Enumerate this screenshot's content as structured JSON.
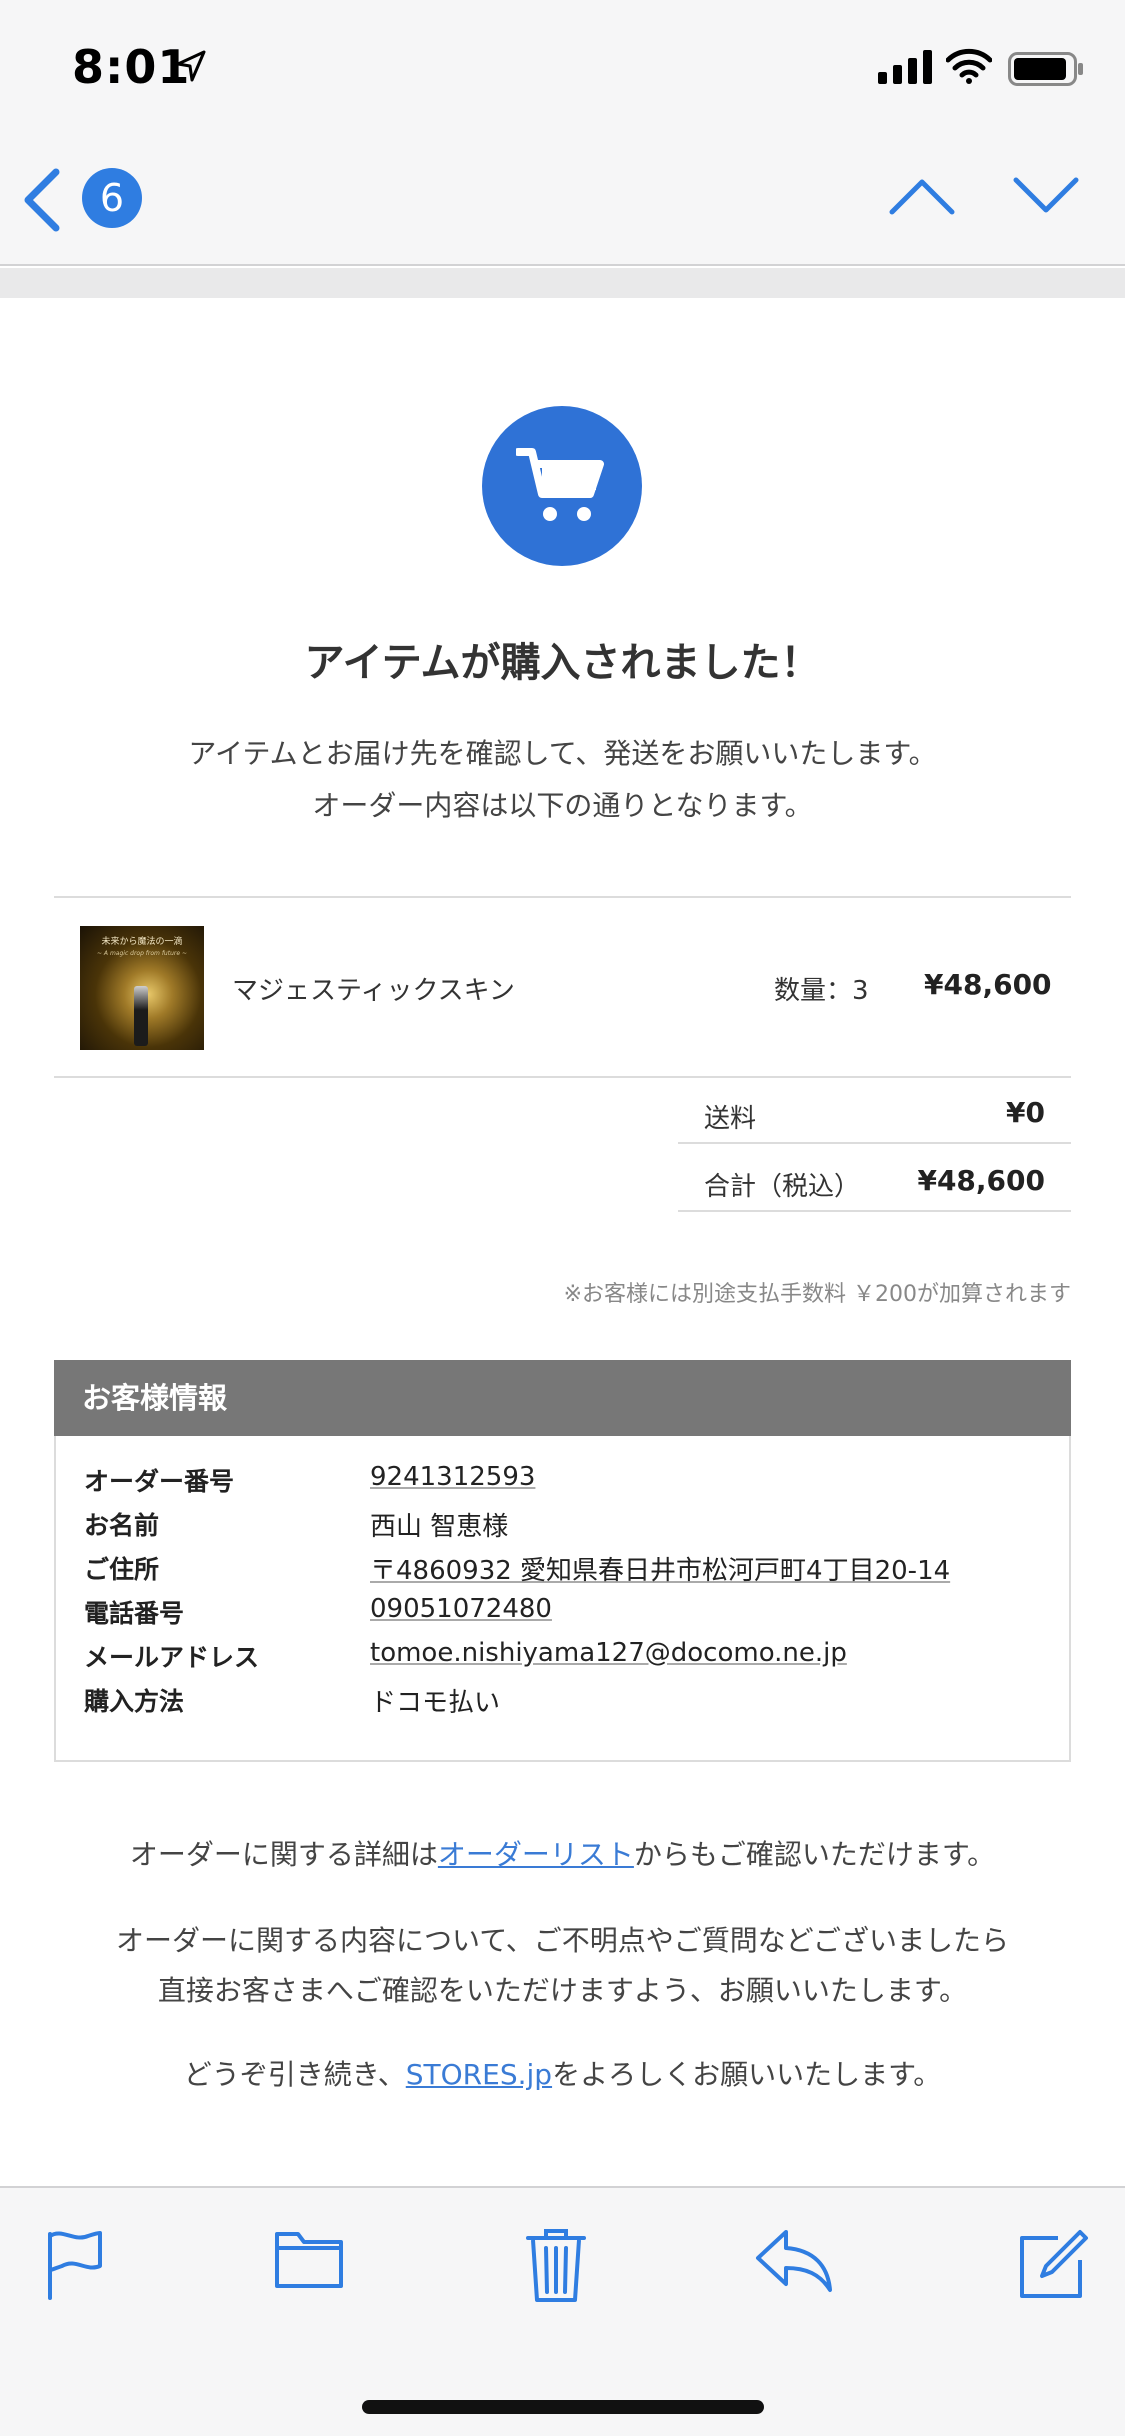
{
  "status_bar": {
    "time": "8:01"
  },
  "nav": {
    "unread_count": "6"
  },
  "order": {
    "headline": "アイテムが購入されました！",
    "intro_line1": "アイテムとお届け先を確認して、発送をお願いいたします。",
    "intro_line2": "オーダー内容は以下の通りとなります。",
    "item": {
      "image_title": "未来から魔法の一滴",
      "image_subtitle": "~ A magic drop from future ~",
      "name": "マジェスティックスキン",
      "quantity": "数量：3",
      "price": "¥48,600"
    },
    "shipping_label": "送料",
    "shipping_value": "¥0",
    "total_label": "合計（税込）",
    "total_value": "¥48,600",
    "note": "※お客様には別途支払手数料 ￥200が加算されます"
  },
  "customer": {
    "header": "お客様情報",
    "rows": [
      {
        "label": "オーダー番号",
        "value": "9241312593"
      },
      {
        "label": "お名前",
        "value": "西山 智恵様"
      },
      {
        "label": "ご住所",
        "value": "〒4860932 愛知県春日井市松河戸町4丁目20-14"
      },
      {
        "label": "電話番号",
        "value": "09051072480"
      },
      {
        "label": "メールアドレス",
        "value": "tomoe.nishiyama127@docomo.ne.jp"
      },
      {
        "label": "購入方法",
        "value": "ドコモ払い"
      }
    ]
  },
  "footer": {
    "details_pre": "オーダーに関する詳細は",
    "details_link": "オーダーリスト",
    "details_post": "からもご確認いただけます。",
    "contact_line1": "オーダーに関する内容について、ご不明点やご質問などございましたら",
    "contact_line2": "直接お客さまへご確認をいただけますよう、お願いいたします。",
    "closing_pre": "どうぞ引き続き、",
    "closing_link": "STORES.jp",
    "closing_post": "をよろしくお願いいたします。"
  },
  "colors": {
    "accent": "#2f7de1",
    "cart_circle": "#2f72d6",
    "header_gray": "#777777"
  },
  "icons": [
    "location-arrow-icon",
    "signal-icon",
    "wifi-icon",
    "battery-icon",
    "back-chevron-icon",
    "chevron-up-icon",
    "chevron-down-icon",
    "cart-icon",
    "flag-icon",
    "folder-icon",
    "trash-icon",
    "reply-icon",
    "compose-icon"
  ]
}
